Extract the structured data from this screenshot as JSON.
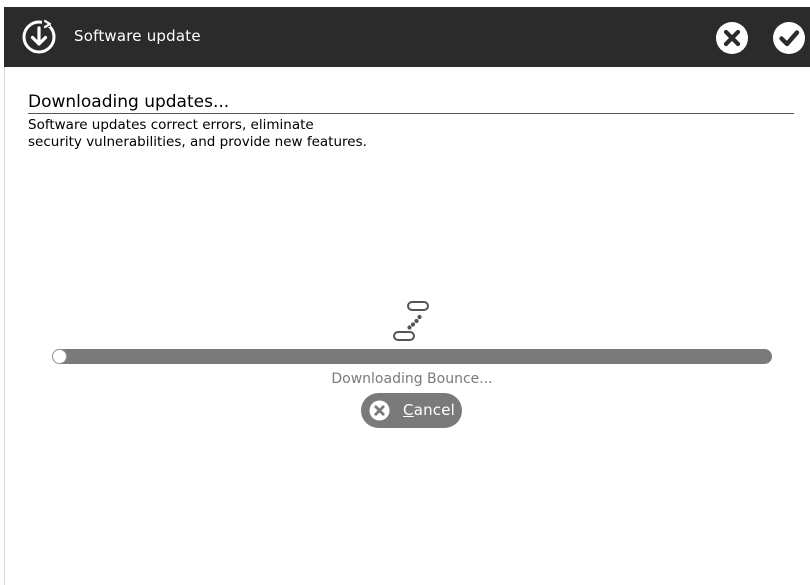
{
  "window": {
    "title": "Software update",
    "app_icon": "download-update-icon",
    "close_icon": "close-icon",
    "confirm_icon": "checkmark-icon"
  },
  "main": {
    "heading": "Downloading updates...",
    "description_lines": [
      "Software updates correct errors, eliminate",
      "security vulnerabilities, and provide new features."
    ]
  },
  "progress": {
    "busy_icon": "busy-spinner-icon",
    "fraction": 0.0,
    "status_text": "Downloading Bounce..."
  },
  "cancel_button": {
    "icon": "close-icon",
    "label": "Cancel",
    "mnemonic": "C",
    "label_rest": "ancel"
  },
  "colors": {
    "titlebar": "#2b2b2b",
    "accent_gray": "#7a7a7a",
    "background": "#ffffff"
  }
}
